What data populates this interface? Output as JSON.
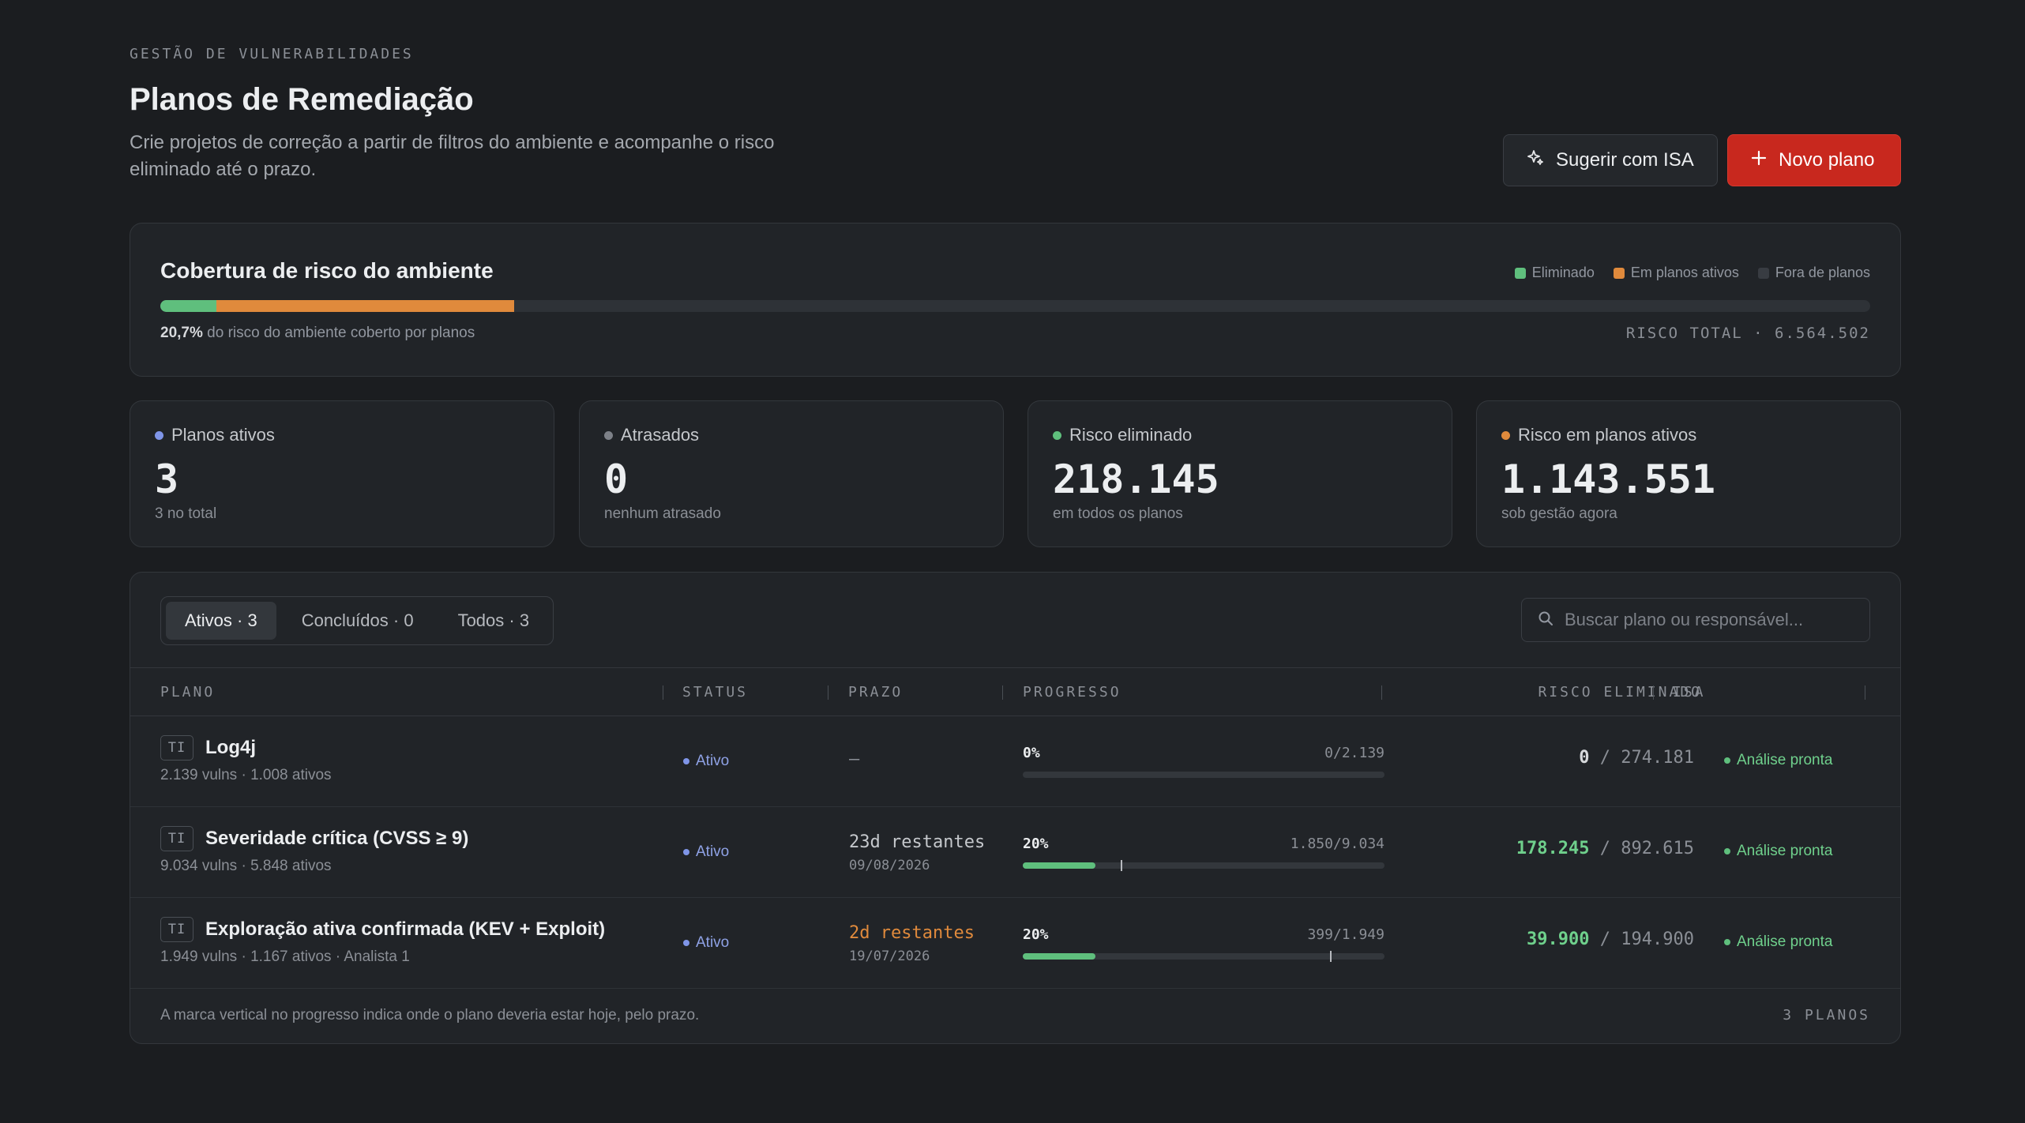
{
  "header": {
    "eyebrow": "GESTÃO DE VULNERABILIDADES",
    "title": "Planos de Remediação",
    "description": "Crie projetos de correção a partir de filtros do ambiente e acompanhe o risco eliminado até o prazo.",
    "suggest_label": "Sugerir com ISA",
    "new_label": "Novo plano"
  },
  "coverage": {
    "title": "Cobertura de risco do ambiente",
    "legend": [
      {
        "label": "Eliminado",
        "color": "#5fbf7d"
      },
      {
        "label": "Em planos ativos",
        "color": "#e08a3c"
      },
      {
        "label": "Fora de planos",
        "color": "#383c42"
      }
    ],
    "eliminated_fraction": 0.033,
    "active_fraction": 0.174,
    "percent": "20,7%",
    "percent_note": "do risco do ambiente coberto por planos",
    "total": "RISCO TOTAL · 6.564.502"
  },
  "stats": [
    {
      "label": "Planos ativos",
      "value": "3",
      "sub": "3 no total",
      "color": "#7f95e8"
    },
    {
      "label": "Atrasados",
      "value": "0",
      "sub": "nenhum atrasado",
      "color": "#7d8188"
    },
    {
      "label": "Risco eliminado",
      "value": "218.145",
      "sub": "em todos os planos",
      "color": "#5fbf7d"
    },
    {
      "label": "Risco em planos ativos",
      "value": "1.143.551",
      "sub": "sob gestão agora",
      "color": "#e08a3c"
    }
  ],
  "tabs": [
    {
      "label": "Ativos · 3",
      "active": true
    },
    {
      "label": "Concluídos · 0",
      "active": false
    },
    {
      "label": "Todos · 3",
      "active": false
    }
  ],
  "search": {
    "placeholder": "Buscar plano ou responsável..."
  },
  "columns": {
    "plan": "PLANO",
    "status": "STATUS",
    "deadline": "PRAZO",
    "progress": "PROGRESSO",
    "risk": "RISCO ELIMINADO",
    "isa": "ISA"
  },
  "rows": [
    {
      "badge": "TI",
      "name": "Log4j",
      "meta": "2.139 vulns · 1.008 ativos",
      "status": "Ativo",
      "deadline": "—",
      "deadline_date": "",
      "deadline_color": "#8b8f96",
      "progress_pct": "0%",
      "progress_count": "0/2.139",
      "progress_fraction": 0,
      "expected_fraction": null,
      "risk_eliminated": "0",
      "risk_total": "274.181",
      "risk_color": "#d7d9dc",
      "isa": "Análise pronta"
    },
    {
      "badge": "TI",
      "name": "Severidade crítica (CVSS ≥ 9)",
      "meta": "9.034 vulns · 5.848 ativos",
      "status": "Ativo",
      "deadline": "23d restantes",
      "deadline_date": "09/08/2026",
      "deadline_color": "#c5c8cc",
      "progress_pct": "20%",
      "progress_count": "1.850/9.034",
      "progress_fraction": 0.2,
      "expected_fraction": 0.27,
      "risk_eliminated": "178.245",
      "risk_total": "892.615",
      "risk_color": "#6fd08c",
      "isa": "Análise pronta"
    },
    {
      "badge": "TI",
      "name": "Exploração ativa confirmada (KEV + Exploit)",
      "meta": "1.949 vulns · 1.167 ativos · Analista 1",
      "status": "Ativo",
      "deadline": "2d restantes",
      "deadline_date": "19/07/2026",
      "deadline_color": "#e08a3c",
      "progress_pct": "20%",
      "progress_count": "399/1.949",
      "progress_fraction": 0.2,
      "expected_fraction": 0.85,
      "risk_eliminated": "39.900",
      "risk_total": "194.900",
      "risk_color": "#6fd08c",
      "isa": "Análise pronta"
    }
  ],
  "footer": {
    "note": "A marca vertical no progresso indica onde o plano deveria estar hoje, pelo prazo.",
    "count": "3 PLANOS"
  }
}
